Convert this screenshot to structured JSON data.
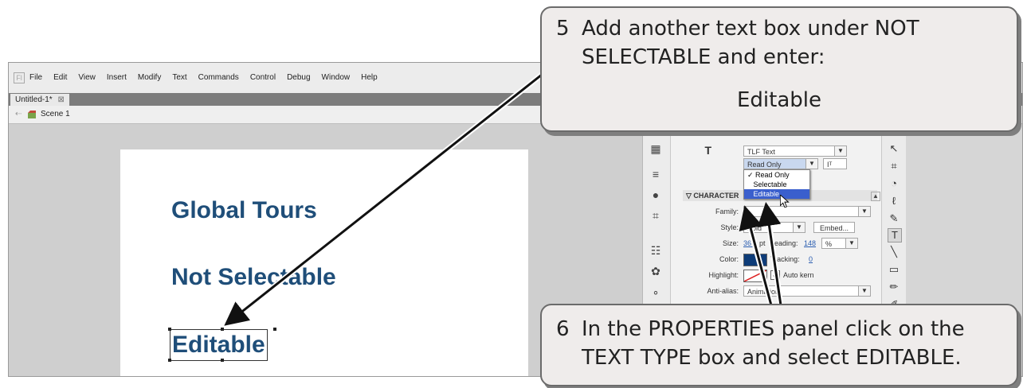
{
  "menu": {
    "logo_label": "Fl",
    "items": [
      "File",
      "Edit",
      "View",
      "Insert",
      "Modify",
      "Text",
      "Commands",
      "Control",
      "Debug",
      "Window",
      "Help"
    ]
  },
  "document": {
    "tab_title": "Untitled-1*",
    "tab_close": "⊠",
    "scene_label": "Scene 1"
  },
  "stage": {
    "line1": "Global Tours",
    "line2": "Not Selectable",
    "line3": "Editable"
  },
  "properties": {
    "text_engine": "TLF Text",
    "text_type": "Read Only",
    "text_type_options": [
      "Read Only",
      "Selectable",
      "Editable"
    ],
    "text_type_highlighted": "Editable",
    "section_character": "CHARACTER",
    "family_label": "Family:",
    "style_label": "Style:",
    "style_value": "Bold",
    "embed_label": "Embed...",
    "size_label": "Size:",
    "size_value": "36.0",
    "size_unit": "pt",
    "leading_label": "Leading:",
    "leading_value": "148",
    "leading_unit": "%",
    "color_label": "Color:",
    "color_swatch": "#0e3c78",
    "tracking_label": "Tracking:",
    "tracking_value": "0",
    "highlight_label": "Highlight:",
    "auto_kern_label": "Auto kern",
    "antialias_label": "Anti-alias:",
    "antialias_value": "Animation"
  },
  "callouts": {
    "step5_number": "5",
    "step5_text": "Add another text box under NOT SELECTABLE and enter:",
    "step5_word": "Editable",
    "step6_number": "6",
    "step6_text": "In the PROPERTIES panel click on the TEXT TYPE box and select EDITABLE."
  },
  "colors": {
    "stage_text": "#1f4e79",
    "callout_bg": "#efeceb",
    "selection_blue": "#3a5fcd"
  }
}
